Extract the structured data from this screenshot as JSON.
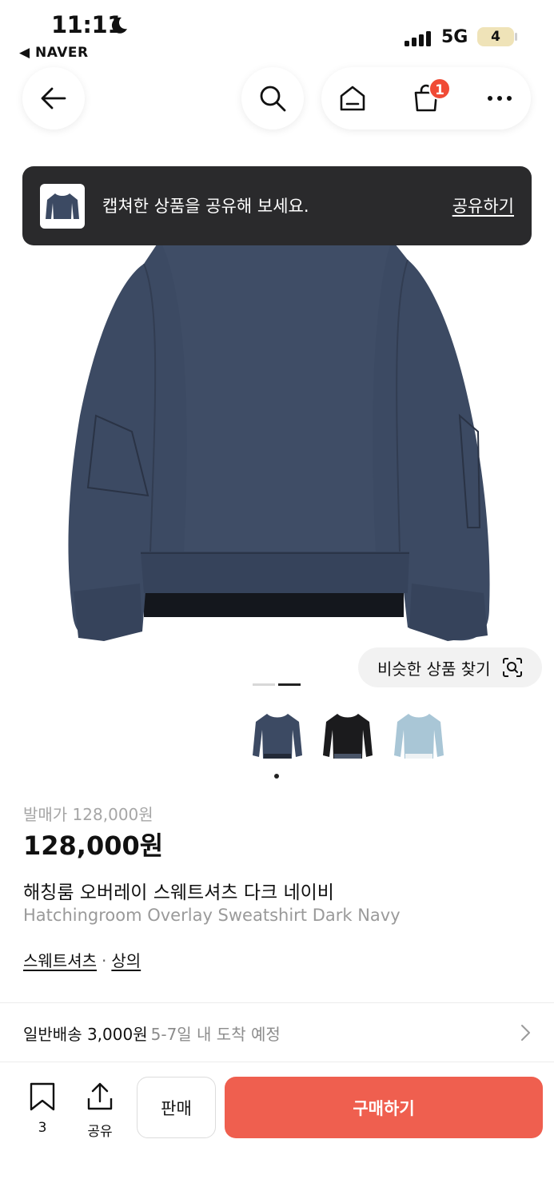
{
  "status_bar": {
    "time": "11:11",
    "back_app": "◀ NAVER",
    "network": "5G",
    "battery": "4"
  },
  "nav": {
    "cart_count": "1"
  },
  "toast": {
    "message": "캡쳐한 상품을 공유해 보세요.",
    "action": "공유하기"
  },
  "gallery": {
    "similar_button": "비슷한 상품 찾기",
    "image_count": 2,
    "current_index": 2,
    "swatches": [
      "dark-navy",
      "black",
      "light-blue"
    ],
    "selected_swatch": 0
  },
  "product": {
    "list_price": "발매가 128,000원",
    "price": "128,000원",
    "title_ko": "해칭룸 오버레이 스웨트셔츠 다크 네이비",
    "title_en": "Hatchingroom Overlay Sweatshirt Dark Navy",
    "category_1": "스웨트셔츠",
    "category_sep": "·",
    "category_2": "상의"
  },
  "delivery": {
    "label": "일반배송 3,000원",
    "eta": "5-7일 내 도착 예정"
  },
  "bottom_bar": {
    "bookmark_count": "3",
    "share_label": "공유",
    "sell_label": "판매",
    "buy_label": "구매하기"
  },
  "colors": {
    "buy_button": "#ef5f4f",
    "badge": "#f04b36",
    "toast_bg": "#2a2a2c",
    "sweatshirt_navy": "#3c4a63"
  }
}
